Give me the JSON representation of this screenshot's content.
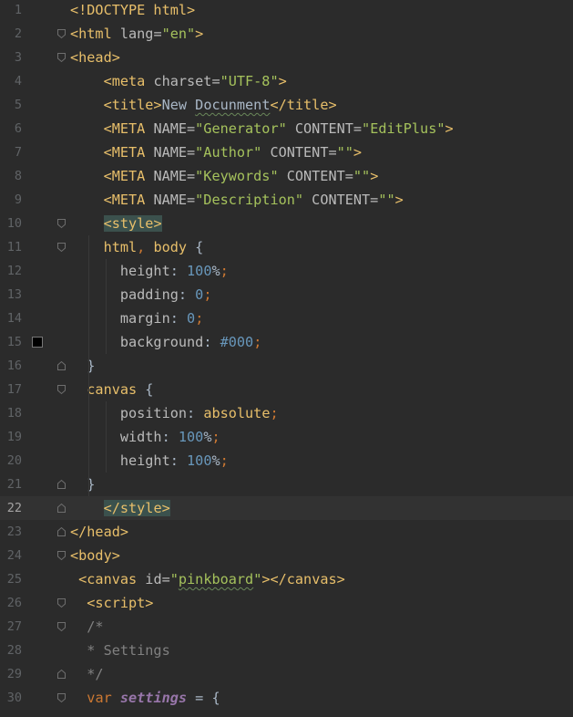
{
  "editor": {
    "lines": [
      {
        "n": "1",
        "segs": [
          {
            "t": "<!DOCTYPE html>",
            "c": "t-tag"
          }
        ]
      },
      {
        "n": "2",
        "segs": [
          {
            "t": "<html ",
            "c": "t-tag"
          },
          {
            "t": "lang=",
            "c": "t-attr"
          },
          {
            "t": "\"en\"",
            "c": "t-str"
          },
          {
            "t": ">",
            "c": "t-tag"
          }
        ]
      },
      {
        "n": "3",
        "segs": [
          {
            "t": "<head>",
            "c": "t-tag"
          }
        ]
      },
      {
        "n": "4",
        "segs": [
          {
            "t": "    <meta ",
            "c": "t-tag"
          },
          {
            "t": "charset=",
            "c": "t-attr"
          },
          {
            "t": "\"UTF-8\"",
            "c": "t-str"
          },
          {
            "t": ">",
            "c": "t-tag"
          }
        ]
      },
      {
        "n": "5",
        "segs": [
          {
            "t": "    <title>",
            "c": "t-tag"
          },
          {
            "t": "New ",
            "c": "t-plain"
          },
          {
            "t": "Docunment",
            "c": "t-plain t-typo"
          },
          {
            "t": "</title>",
            "c": "t-tag"
          }
        ]
      },
      {
        "n": "6",
        "segs": [
          {
            "t": "    <META ",
            "c": "t-tag"
          },
          {
            "t": "NAME=",
            "c": "t-attr"
          },
          {
            "t": "\"Generator\"",
            "c": "t-str"
          },
          {
            "t": " CONTENT=",
            "c": "t-attr"
          },
          {
            "t": "\"EditPlus\"",
            "c": "t-str"
          },
          {
            "t": ">",
            "c": "t-tag"
          }
        ]
      },
      {
        "n": "7",
        "segs": [
          {
            "t": "    <META ",
            "c": "t-tag"
          },
          {
            "t": "NAME=",
            "c": "t-attr"
          },
          {
            "t": "\"Author\"",
            "c": "t-str"
          },
          {
            "t": " CONTENT=",
            "c": "t-attr"
          },
          {
            "t": "\"\"",
            "c": "t-str"
          },
          {
            "t": ">",
            "c": "t-tag"
          }
        ]
      },
      {
        "n": "8",
        "segs": [
          {
            "t": "    <META ",
            "c": "t-tag"
          },
          {
            "t": "NAME=",
            "c": "t-attr"
          },
          {
            "t": "\"Keywords\"",
            "c": "t-str"
          },
          {
            "t": " CONTENT=",
            "c": "t-attr"
          },
          {
            "t": "\"\"",
            "c": "t-str"
          },
          {
            "t": ">",
            "c": "t-tag"
          }
        ]
      },
      {
        "n": "9",
        "segs": [
          {
            "t": "    <META ",
            "c": "t-tag"
          },
          {
            "t": "NAME=",
            "c": "t-attr"
          },
          {
            "t": "\"Description\"",
            "c": "t-str"
          },
          {
            "t": " CONTENT=",
            "c": "t-attr"
          },
          {
            "t": "\"\"",
            "c": "t-str"
          },
          {
            "t": ">",
            "c": "t-tag"
          }
        ]
      },
      {
        "n": "10",
        "segs": [
          {
            "t": "    ",
            "c": "t-plain"
          },
          {
            "t": "<style>",
            "c": "t-tag t-stylehl"
          }
        ]
      },
      {
        "n": "11",
        "segs": [
          {
            "t": "    html",
            "c": "t-sel"
          },
          {
            "t": ", ",
            "c": "t-kw"
          },
          {
            "t": "body ",
            "c": "t-sel"
          },
          {
            "t": "{",
            "c": "t-plain"
          }
        ]
      },
      {
        "n": "12",
        "segs": [
          {
            "t": "      height",
            "c": "t-prop"
          },
          {
            "t": ": ",
            "c": "t-plain"
          },
          {
            "t": "100",
            "c": "t-num"
          },
          {
            "t": "%",
            "c": "t-plain"
          },
          {
            "t": ";",
            "c": "t-kw"
          }
        ]
      },
      {
        "n": "13",
        "segs": [
          {
            "t": "      padding",
            "c": "t-prop"
          },
          {
            "t": ": ",
            "c": "t-plain"
          },
          {
            "t": "0",
            "c": "t-num"
          },
          {
            "t": ";",
            "c": "t-kw"
          }
        ]
      },
      {
        "n": "14",
        "segs": [
          {
            "t": "      margin",
            "c": "t-prop"
          },
          {
            "t": ": ",
            "c": "t-plain"
          },
          {
            "t": "0",
            "c": "t-num"
          },
          {
            "t": ";",
            "c": "t-kw"
          }
        ]
      },
      {
        "n": "15",
        "segs": [
          {
            "t": "      background",
            "c": "t-prop"
          },
          {
            "t": ": ",
            "c": "t-plain"
          },
          {
            "t": "#000",
            "c": "t-num"
          },
          {
            "t": ";",
            "c": "t-kw"
          }
        ],
        "swatch": true
      },
      {
        "n": "16",
        "segs": [
          {
            "t": "  }",
            "c": "t-plain"
          }
        ]
      },
      {
        "n": "17",
        "segs": [
          {
            "t": "  canvas ",
            "c": "t-sel"
          },
          {
            "t": "{",
            "c": "t-plain"
          }
        ]
      },
      {
        "n": "18",
        "segs": [
          {
            "t": "      position",
            "c": "t-prop"
          },
          {
            "t": ": ",
            "c": "t-plain"
          },
          {
            "t": "absolute",
            "c": "t-tag"
          },
          {
            "t": ";",
            "c": "t-kw"
          }
        ]
      },
      {
        "n": "19",
        "segs": [
          {
            "t": "      width",
            "c": "t-prop"
          },
          {
            "t": ": ",
            "c": "t-plain"
          },
          {
            "t": "100",
            "c": "t-num"
          },
          {
            "t": "%",
            "c": "t-plain"
          },
          {
            "t": ";",
            "c": "t-kw"
          }
        ]
      },
      {
        "n": "20",
        "segs": [
          {
            "t": "      height",
            "c": "t-prop"
          },
          {
            "t": ": ",
            "c": "t-plain"
          },
          {
            "t": "100",
            "c": "t-num"
          },
          {
            "t": "%",
            "c": "t-plain"
          },
          {
            "t": ";",
            "c": "t-kw"
          }
        ]
      },
      {
        "n": "21",
        "segs": [
          {
            "t": "  }",
            "c": "t-plain"
          }
        ]
      },
      {
        "n": "22",
        "segs": [
          {
            "t": "    ",
            "c": "t-plain"
          },
          {
            "t": "</style>",
            "c": "t-tag t-stylehl"
          }
        ],
        "current": true
      },
      {
        "n": "23",
        "segs": [
          {
            "t": "</head>",
            "c": "t-tag"
          }
        ]
      },
      {
        "n": "24",
        "segs": [
          {
            "t": "<body>",
            "c": "t-tag"
          }
        ]
      },
      {
        "n": "25",
        "segs": [
          {
            "t": " <canvas ",
            "c": "t-tag"
          },
          {
            "t": "id=",
            "c": "t-attr"
          },
          {
            "t": "\"",
            "c": "t-str"
          },
          {
            "t": "pinkboard",
            "c": "t-str t-typo"
          },
          {
            "t": "\"",
            "c": "t-str"
          },
          {
            "t": "></canvas>",
            "c": "t-tag"
          }
        ]
      },
      {
        "n": "26",
        "segs": [
          {
            "t": "  <script>",
            "c": "t-tag"
          }
        ]
      },
      {
        "n": "27",
        "segs": [
          {
            "t": "  /*",
            "c": "t-cmt"
          }
        ]
      },
      {
        "n": "28",
        "segs": [
          {
            "t": "  * Settings",
            "c": "t-cmt"
          }
        ]
      },
      {
        "n": "29",
        "segs": [
          {
            "t": "  */",
            "c": "t-cmt"
          }
        ]
      },
      {
        "n": "30",
        "segs": [
          {
            "t": "  ",
            "c": "t-plain"
          },
          {
            "t": "var ",
            "c": "t-kw"
          },
          {
            "t": "settings",
            "c": "t-var"
          },
          {
            "t": " = {",
            "c": "t-plain"
          }
        ]
      }
    ],
    "folds": {
      "2": "open",
      "3": "open",
      "10": "open",
      "11": "open",
      "16": "close",
      "17": "open",
      "21": "close",
      "22": "close",
      "23": "close",
      "24": "open",
      "26": "open",
      "27": "open",
      "29": "close",
      "30": "open"
    },
    "colors": {
      "background": "#2b2b2b",
      "current_line": "#323232",
      "tag": "#e8bf6a",
      "string": "#a5c25c",
      "number": "#6897bb",
      "keyword": "#cc7832",
      "comment": "#808080"
    }
  }
}
